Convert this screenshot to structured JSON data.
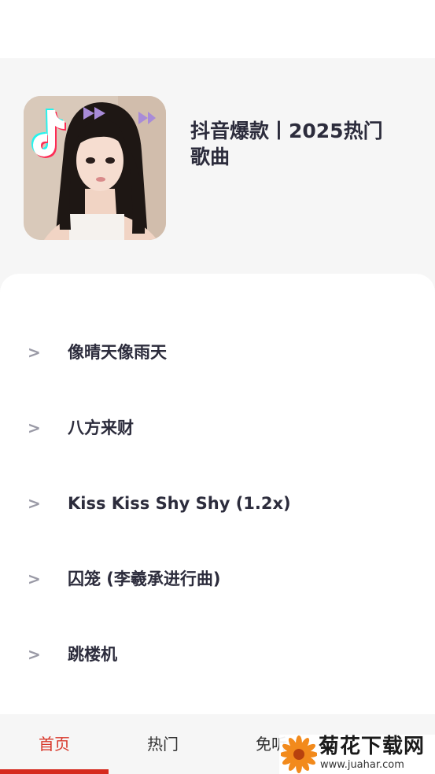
{
  "playlist": {
    "title": "抖音爆款丨2025热门歌曲"
  },
  "songs": [
    {
      "arrow": ">",
      "name": "像晴天像雨天"
    },
    {
      "arrow": ">",
      "name": "八方来财"
    },
    {
      "arrow": ">",
      "name": "Kiss Kiss Shy Shy (1.2x)"
    },
    {
      "arrow": ">",
      "name": "囚笼 (李羲承进行曲)"
    },
    {
      "arrow": ">",
      "name": "跳楼机"
    }
  ],
  "tabs": [
    {
      "label": "首页",
      "active": true
    },
    {
      "label": "热门",
      "active": false
    },
    {
      "label": "免听",
      "active": false
    }
  ],
  "colors": {
    "accent": "#d62a1e",
    "title_text": "#2c2c3c",
    "header_bg": "#f6f6f6"
  },
  "watermark": {
    "name": "菊花下载网",
    "url": "www.juahar.com",
    "icon": "chrysanthemum-flower-icon"
  },
  "cover": {
    "icon": "tiktok-note-icon"
  }
}
